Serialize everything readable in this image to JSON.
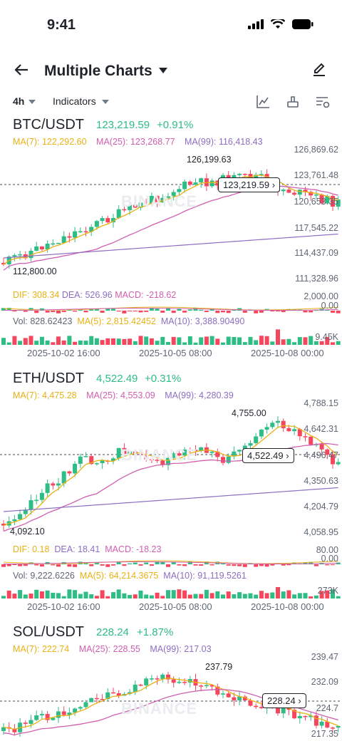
{
  "status": {
    "time": "9:41"
  },
  "header": {
    "title": "Multiple Charts"
  },
  "toolbar": {
    "timeframe": "4h",
    "indicators": "Indicators"
  },
  "watermark": "BINANCE",
  "panels": [
    {
      "pair": "BTC/USDT",
      "price": "123,219.59",
      "change": "+0.91%",
      "ma7": "MA(7): 122,292.60",
      "ma25": "MA(25): 123,268.77",
      "ma99": "MA(99): 116,418.43",
      "yticks": [
        "126,869.62",
        "123,761.48",
        "120,653.35",
        "117,545.22",
        "114,437.09",
        "111,328.96"
      ],
      "high_label": "126,199.63",
      "low_label": "112,800.00",
      "current_tag": "123,219.59",
      "macd": {
        "dif": "DIF: 308.34",
        "dea": "DEA: 526.96",
        "macd": "MACD: -218.62",
        "top": "2,000.00",
        "zero": "0.00"
      },
      "vol": {
        "vol": "Vol: 828.62423",
        "ma5": "MA(5): 2,815.42452",
        "ma10": "MA(10): 3,388.90490",
        "right": "9.45K"
      },
      "xlabels": [
        "2025-10-02 16:00",
        "2025-10-05 08:00",
        "2025-10-08 00:00"
      ]
    },
    {
      "pair": "ETH/USDT",
      "price": "4,522.49",
      "change": "+0.31%",
      "ma7": "MA(7): 4,475.28",
      "ma25": "MA(25): 4,553.09",
      "ma99": "MA(99): 4,280.39",
      "yticks": [
        "4,788.15",
        "4,642.31",
        "4,496.47",
        "4,350.63",
        "4,204.79",
        "4,058.95"
      ],
      "high_label": "4,755.00",
      "low_label": "4,092.10",
      "current_tag": "4,522.49",
      "macd": {
        "dif": "DIF: 0.18",
        "dea": "DEA: 18.41",
        "macd": "MACD: -18.23",
        "top": "80.00",
        "zero": "0.00"
      },
      "vol": {
        "vol": "Vol: 9,222.6226",
        "ma5": "MA(5): 64,214.3675",
        "ma10": "MA(10): 91,119.5261",
        "right": "273K"
      },
      "xlabels": [
        "2025-10-02 16:00",
        "2025-10-05 08:00",
        "2025-10-08 00:00"
      ]
    },
    {
      "pair": "SOL/USDT",
      "price": "228.24",
      "change": "+1.87%",
      "ma7": "MA(7): 222.74",
      "ma25": "MA(25): 228.55",
      "ma99": "MA(99): 217.03",
      "yticks": [
        "239.47",
        "232.09",
        "224.7",
        "217.35"
      ],
      "high_label": "237.79",
      "current_tag": "228.24"
    }
  ],
  "colors": {
    "up": "#2ebd85",
    "down": "#f6465d",
    "ma7": "#e9b114",
    "ma25": "#d05fb0",
    "ma99": "#8c6ec2"
  }
}
